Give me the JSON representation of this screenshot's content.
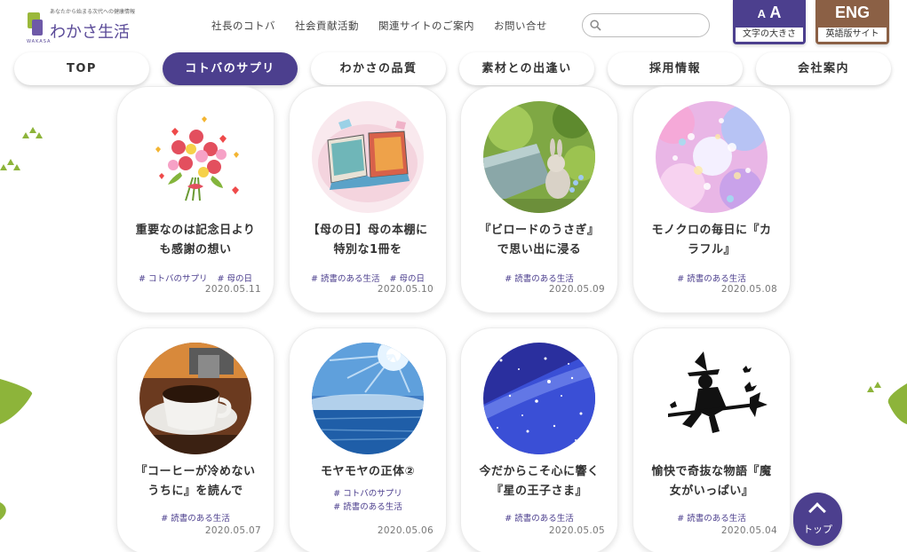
{
  "header": {
    "tagline": "あなたから始まる次代への健康情報",
    "logo_text": "わかさ生活",
    "logo_sub": "WAKASA"
  },
  "topnav": [
    "社長のコトバ",
    "社会貢献活動",
    "関連サイトのご案内",
    "お問い合せ"
  ],
  "search": {
    "value": "",
    "placeholder": ""
  },
  "tools": {
    "size_glyph_small": "A",
    "size_glyph_large": "A",
    "size_label": "文字の大きさ",
    "eng_glyph": "ENG",
    "eng_label": "英語版サイト"
  },
  "mainnav": [
    {
      "label": "TOP",
      "active": false
    },
    {
      "label": "コトバのサプリ",
      "active": true
    },
    {
      "label": "わかさの品質",
      "active": false
    },
    {
      "label": "素材との出逢い",
      "active": false
    },
    {
      "label": "採用情報",
      "active": false
    },
    {
      "label": "会社案内",
      "active": false
    }
  ],
  "articles": [
    {
      "title_lines": [
        "重要なのは記念日より",
        "も感謝の想い"
      ],
      "tags": [
        "# コトバのサプリ",
        "# 母の日"
      ],
      "date": "2020.05.11",
      "image": "bouquet-icon"
    },
    {
      "title_lines": [
        "【母の日】母の本棚に",
        "特別な1冊を"
      ],
      "tags": [
        "# 読書のある生活",
        "# 母の日"
      ],
      "date": "2020.05.10",
      "image": "books-icon"
    },
    {
      "title_lines": [
        "『ビロードのうさぎ』",
        "で思い出に浸る"
      ],
      "tags": [
        "# 読書のある生活"
      ],
      "date": "2020.05.09",
      "image": "rabbit-icon"
    },
    {
      "title_lines": [
        "モノクロの毎日に『カ",
        "ラフル』"
      ],
      "tags": [
        "# 読書のある生活"
      ],
      "date": "2020.05.08",
      "image": "bokeh-icon"
    },
    {
      "title_lines": [
        "『コーヒーが冷めない",
        "うちに』を読んで"
      ],
      "tags": [
        "# 読書のある生活"
      ],
      "date": "2020.05.07",
      "image": "coffee-icon"
    },
    {
      "title_lines": [
        "モヤモヤの正体②"
      ],
      "tags": [
        "# コトバのサプリ",
        "# 読書のある生活"
      ],
      "date": "2020.05.06",
      "image": "sky-sea-icon"
    },
    {
      "title_lines": [
        "今だからこそ心に響く",
        "『星の王子さま』"
      ],
      "tags": [
        "# 読書のある生活"
      ],
      "date": "2020.05.05",
      "image": "starry-sky-icon"
    },
    {
      "title_lines": [
        "愉快で奇抜な物語『魔",
        "女がいっぱい』"
      ],
      "tags": [
        "# 読書のある生活"
      ],
      "date": "2020.05.04",
      "image": "witch-icon"
    }
  ],
  "totop_label": "トップ",
  "colors": {
    "brand_purple": "#4c3f8e",
    "eng_brown": "#8b6045",
    "leaf_green": "#8db43a"
  }
}
